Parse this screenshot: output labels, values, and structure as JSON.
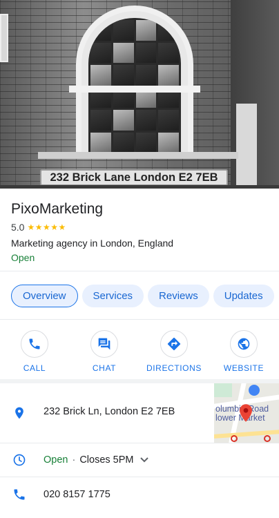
{
  "hero": {
    "sign_text": "232 Brick Lane London E2 7EB"
  },
  "place": {
    "name": "PixoMarketing",
    "rating": "5.0",
    "stars": "★★★★★",
    "category": "Marketing agency in London, England",
    "status": "Open"
  },
  "tabs": [
    {
      "label": "Overview",
      "active": true
    },
    {
      "label": "Services",
      "active": false
    },
    {
      "label": "Reviews",
      "active": false
    },
    {
      "label": "Updates",
      "active": false
    }
  ],
  "actions": {
    "call": "CALL",
    "chat": "CHAT",
    "directions": "DIRECTIONS",
    "website": "WEBSITE"
  },
  "address": {
    "text": "232 Brick Ln, London E2 7EB",
    "map_label_line1": "olumbia Road",
    "map_label_line2": "lower Market"
  },
  "hours": {
    "status": "Open",
    "separator": "·",
    "closes": "Closes 5PM"
  },
  "phone": {
    "number": "020 8157 1775"
  },
  "colors": {
    "accent": "#1a73e8",
    "open_green": "#188038",
    "star_yellow": "#fbbc04",
    "marker_red": "#ea4335"
  }
}
